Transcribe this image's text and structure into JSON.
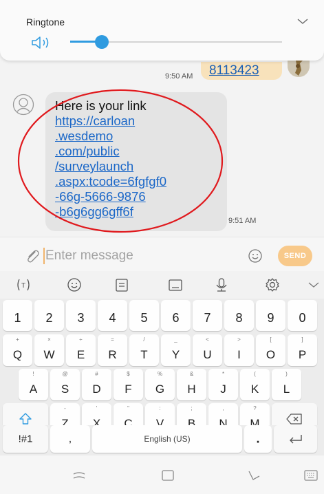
{
  "ringtone": {
    "title": "Ringtone",
    "volume_percent": 15,
    "icons": {
      "collapse": "chevron-down-icon",
      "volume": "speaker-icon"
    }
  },
  "conversation": {
    "sent": {
      "number_text": "8113423",
      "time": "9:50 AM"
    },
    "received": {
      "intro": "Here is your link",
      "link_lines": [
        "https://carloan",
        ".wesdemo",
        ".com/public",
        "/surveylaunch",
        ".aspx:tcode=6fgfgf0",
        "-66g-5666-9876",
        "-b6g6gg6gff6f"
      ],
      "time": "9:51 AM"
    },
    "highlight_color": "#e0191d"
  },
  "compose": {
    "placeholder": "Enter message",
    "send_label": "SEND",
    "accent": "#f8c98a"
  },
  "keyboard": {
    "toolbar": [
      "t-icon",
      "emoji-icon",
      "clipboard-icon",
      "keyboard-icon",
      "mic-icon",
      "settings-icon",
      "chevron-down-icon"
    ],
    "number_row": [
      "1",
      "2",
      "3",
      "4",
      "5",
      "6",
      "7",
      "8",
      "9",
      "0"
    ],
    "row1": [
      {
        "key": "Q",
        "hint": "+"
      },
      {
        "key": "W",
        "hint": "×"
      },
      {
        "key": "E",
        "hint": "÷"
      },
      {
        "key": "R",
        "hint": "="
      },
      {
        "key": "T",
        "hint": "/"
      },
      {
        "key": "Y",
        "hint": "_"
      },
      {
        "key": "U",
        "hint": "<"
      },
      {
        "key": "I",
        "hint": ">"
      },
      {
        "key": "O",
        "hint": "["
      },
      {
        "key": "P",
        "hint": "]"
      }
    ],
    "row2": [
      {
        "key": "A",
        "hint": "!"
      },
      {
        "key": "S",
        "hint": "@"
      },
      {
        "key": "D",
        "hint": "#"
      },
      {
        "key": "F",
        "hint": "$"
      },
      {
        "key": "G",
        "hint": "%"
      },
      {
        "key": "H",
        "hint": "&"
      },
      {
        "key": "J",
        "hint": "*"
      },
      {
        "key": "K",
        "hint": "("
      },
      {
        "key": "L",
        "hint": ")"
      }
    ],
    "row3": [
      {
        "key": "Z",
        "hint": "-"
      },
      {
        "key": "X",
        "hint": "'"
      },
      {
        "key": "C",
        "hint": "\""
      },
      {
        "key": "V",
        "hint": ":"
      },
      {
        "key": "B",
        "hint": ";"
      },
      {
        "key": "N",
        "hint": ","
      },
      {
        "key": "M",
        "hint": "?"
      }
    ],
    "symbols_label": "!#1",
    "comma_label": ",",
    "space_label": "English (US)",
    "period_label": "."
  },
  "navbar": [
    "recent-apps-icon",
    "home-icon",
    "back-icon",
    "keyboard-switch-icon"
  ]
}
